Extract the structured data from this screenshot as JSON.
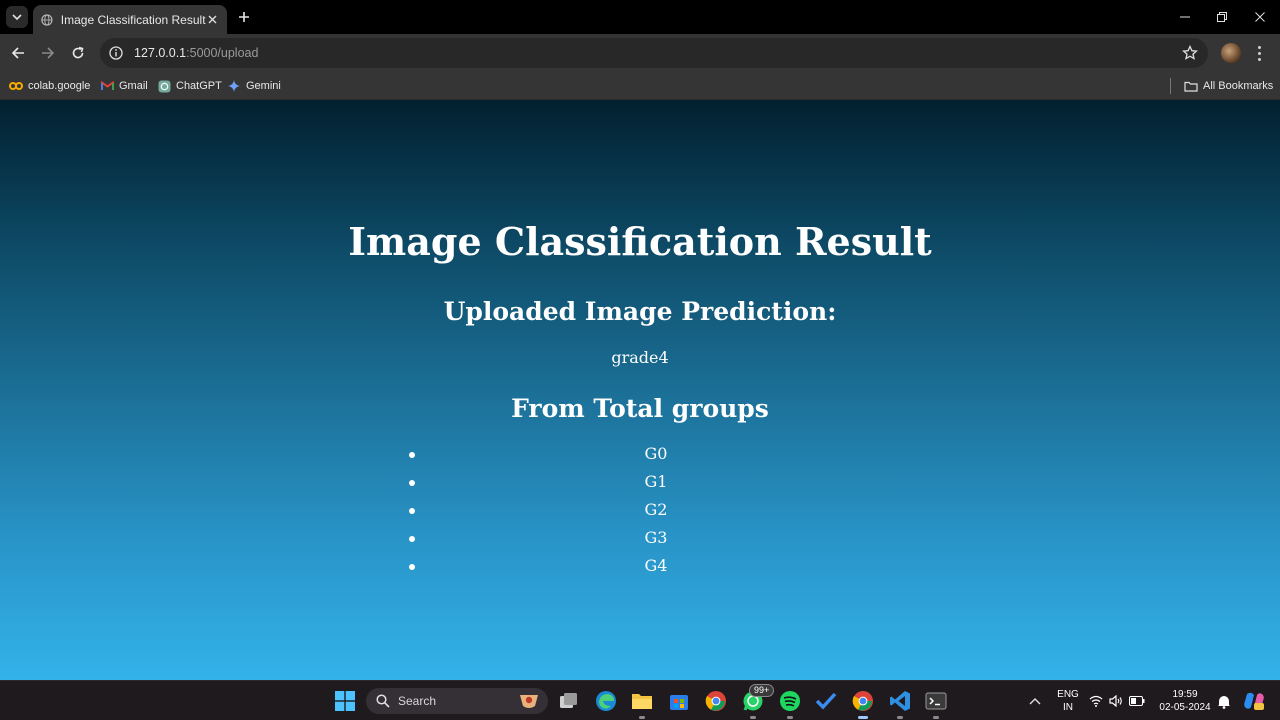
{
  "browser": {
    "tab": {
      "title": "Image Classification Result"
    },
    "address": {
      "host": "127.0.0.1",
      "rest": ":5000/upload"
    },
    "bookmarks": [
      {
        "label": "colab.google",
        "icon": "colab-icon"
      },
      {
        "label": "Gmail",
        "icon": "gmail-icon"
      },
      {
        "label": "ChatGPT",
        "icon": "chatgpt-icon"
      },
      {
        "label": "Gemini",
        "icon": "gemini-icon"
      }
    ],
    "all_bookmarks": "All Bookmarks"
  },
  "page": {
    "title": "Image Classification Result",
    "prediction_heading": "Uploaded Image Prediction:",
    "prediction": "grade4",
    "groups_heading": "From Total groups",
    "groups": [
      "G0",
      "G1",
      "G2",
      "G3",
      "G4"
    ]
  },
  "taskbar": {
    "search_label": "Search",
    "whatsapp_badge": "99+",
    "language": {
      "line1": "ENG",
      "line2": "IN"
    },
    "clock": {
      "time": "19:59",
      "date": "02-05-2024"
    }
  },
  "colors": {
    "page_gradient_top": "#02202f",
    "page_gradient_bottom": "#33b2ea",
    "text": "#ffffff"
  }
}
